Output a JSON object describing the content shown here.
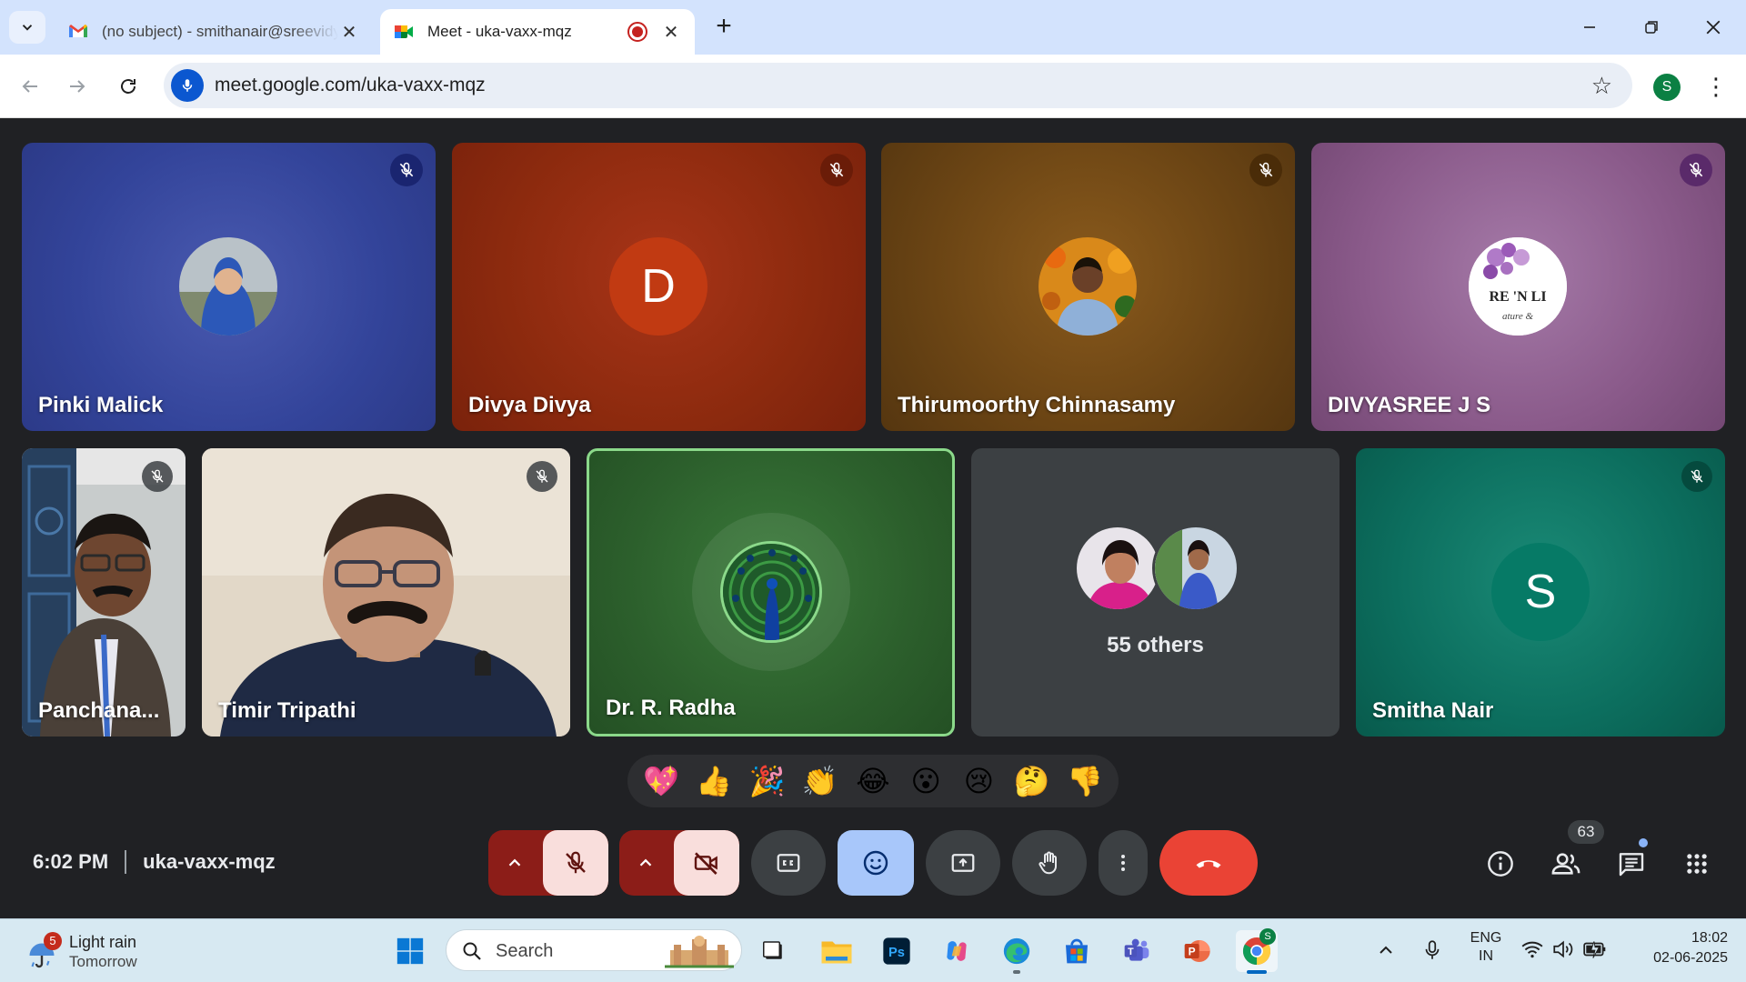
{
  "browser": {
    "tabs": [
      {
        "title": "(no subject) - smithanair@sreevidyaniketan.org",
        "favicon": "gmail-icon",
        "active": false
      },
      {
        "title": "Meet - uka-vaxx-mqz",
        "favicon": "meet-icon",
        "active": true,
        "recording": true
      }
    ],
    "url": "meet.google.com/uka-vaxx-mqz",
    "profile_initial": "S"
  },
  "meeting": {
    "time": "6:02 PM",
    "code": "uka-vaxx-mqz",
    "participants_count": "63",
    "tiles_row1": [
      {
        "name": "Pinki Malick",
        "type": "photo",
        "bg": "#3a4a9a",
        "muted": true
      },
      {
        "name": "Divya Divya",
        "type": "letter",
        "letter": "D",
        "bg": "#9a2a10",
        "muted": true
      },
      {
        "name": "Thirumoorthy Chinnasamy",
        "type": "photo",
        "bg": "#6a4414",
        "muted": true
      },
      {
        "name": "DIVYASREE J S",
        "type": "logo",
        "logo_text": "RE 'N LI",
        "logo_sub": "ature &",
        "bg": "#8a5a8a",
        "muted": true
      }
    ],
    "tiles_row2": [
      {
        "name": "Panchana...",
        "type": "video",
        "muted": true
      },
      {
        "name": "Timir Tripathi",
        "type": "video",
        "muted": true
      },
      {
        "name": "Dr. R. Radha",
        "type": "speaking",
        "bg": "#2c5f2c",
        "muted": false
      },
      {
        "name": "55 others",
        "type": "others"
      },
      {
        "name": "Smitha Nair",
        "type": "letter",
        "letter": "S",
        "bg": "#0c6e5e",
        "muted": true
      }
    ],
    "reactions": [
      "💖",
      "👍",
      "🎉",
      "👏",
      "😂",
      "😮",
      "😢",
      "🤔",
      "👎"
    ],
    "controls": [
      "mic-options",
      "mic-off",
      "camera-options",
      "camera-off",
      "captions",
      "emoji-reactions",
      "present",
      "raise-hand",
      "more-options",
      "leave-call"
    ],
    "right_controls": [
      "meeting-details",
      "people",
      "chat",
      "activities"
    ]
  },
  "taskbar": {
    "weather": {
      "badge": "5",
      "condition": "Light rain",
      "when": "Tomorrow"
    },
    "search_label": "Search",
    "apps": [
      "start",
      "search",
      "task-view",
      "file-explorer",
      "photoshop",
      "copilot",
      "edge",
      "microsoft-store",
      "teams",
      "powerpoint",
      "chrome"
    ],
    "language": "ENG",
    "region": "IN",
    "time": "18:02",
    "date": "02-06-2025"
  },
  "colors": {
    "meet_bg": "#202124",
    "danger": "#ea4335",
    "active_speaker_border": "#8bd98a",
    "reactions_active": "#a8c7fa"
  }
}
